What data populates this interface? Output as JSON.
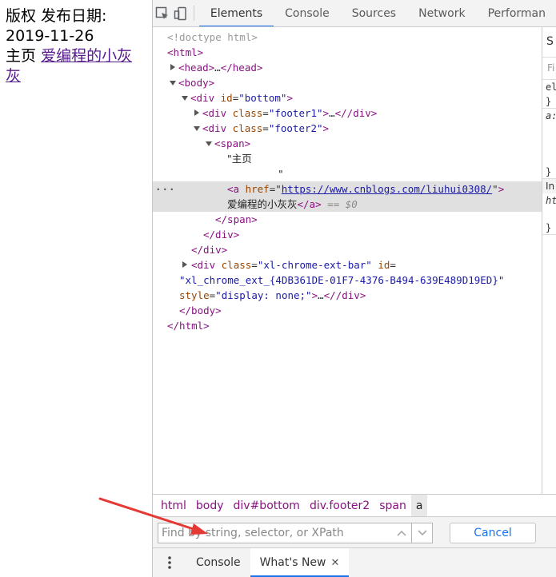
{
  "page": {
    "line1": "版权 发布日期:",
    "line2": "2019-11-26",
    "line3_text": "主页",
    "line3_link": "爱编程的小灰灰"
  },
  "devtools": {
    "tabs": [
      "Elements",
      "Console",
      "Sources",
      "Network",
      "Performan"
    ],
    "active_tab": "Elements",
    "tree": {
      "doctype": "<!doctype html>",
      "html_open": "html",
      "head": "head",
      "head_ellipsis": "…",
      "body": "body",
      "div_bottom_tag": "div",
      "div_bottom_attr": "id",
      "div_bottom_val": "\"bottom\"",
      "div_footer1_tag": "div",
      "div_footer1_attr": "class",
      "div_footer1_val": "\"footer1\"",
      "div_footer2_tag": "div",
      "div_footer2_attr": "class",
      "div_footer2_val": "\"footer2\"",
      "span": "span",
      "text_home": "\"主页",
      "text_quote": "\"",
      "a_tag": "a",
      "a_attr": "href",
      "a_href": "https://www.cnblogs.com/liuhui0308/",
      "a_text": "爱编程的小灰灰",
      "a_close": "/a",
      "eq_sel": "== $0",
      "span_close": "/span",
      "div_close": "/div",
      "ext_tag": "div",
      "ext_class_attr": "class",
      "ext_class_val": "\"xl-chrome-ext-bar\"",
      "ext_id_attr": "id",
      "ext_id_val": "\"xl_chrome_ext_{4DB361DE-01F7-4376-B494-639E489D19ED}\"",
      "ext_style_attr": "style",
      "ext_style_val": "\"display: none;\"",
      "body_close": "/body",
      "html_close": "/html",
      "ellipsis": "…"
    },
    "styles_pane": {
      "header": "S",
      "filter": "Fi",
      "row1": "el",
      "row2": "}",
      "row3": "a:",
      "row4": "}",
      "row5": "In",
      "row6": "ht",
      "row7": "}"
    },
    "breadcrumb": [
      {
        "label": "html"
      },
      {
        "label": "body"
      },
      {
        "label": "div#bottom"
      },
      {
        "label": "div.footer2"
      },
      {
        "label": "span"
      },
      {
        "label": "a"
      }
    ],
    "search": {
      "placeholder": "Find by string, selector, or XPath",
      "cancel_label": "Cancel"
    },
    "drawer": {
      "tabs": [
        "Console",
        "What's New"
      ],
      "active_tab": "What's New"
    }
  },
  "colors": {
    "tag": "#881280",
    "attr": "#994500",
    "value": "#1a1aa6",
    "accent": "#1a73e8",
    "annotation_arrow": "#e53935"
  }
}
